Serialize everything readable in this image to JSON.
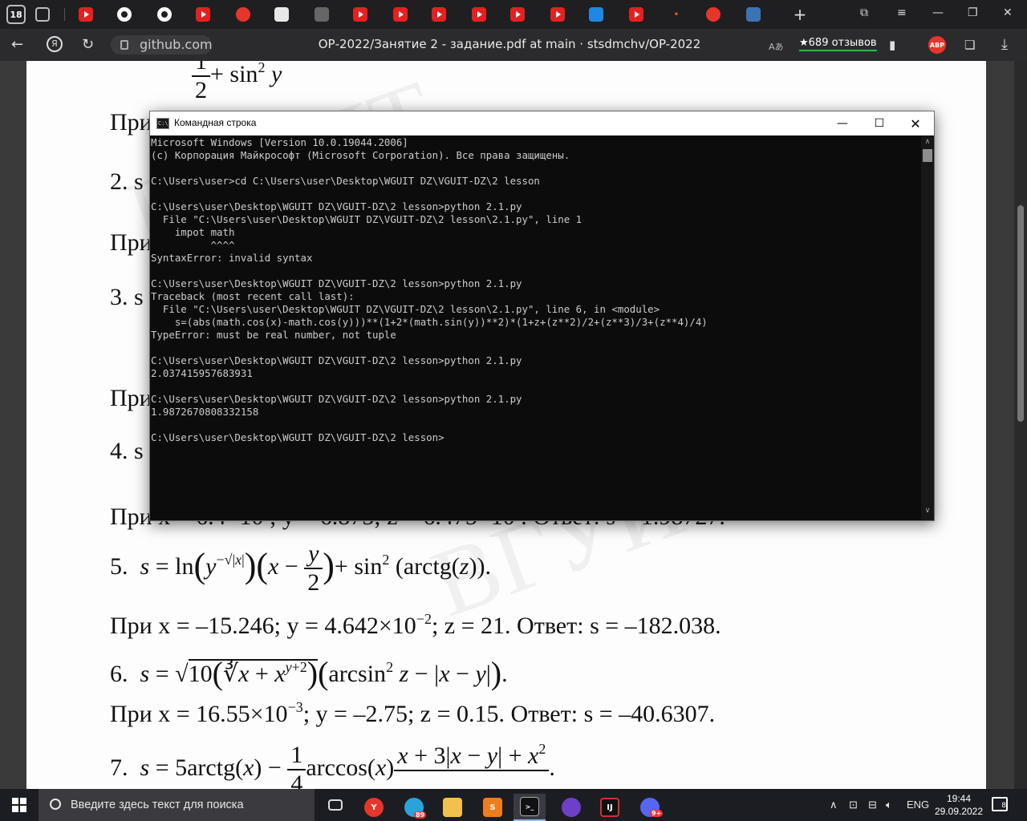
{
  "browser": {
    "tab_count": "18",
    "site": "github.com",
    "page_title": "ОР-2022/Занятие 2 - задание.pdf at main · stsdmchv/OP-2022",
    "reviews": "★689 отзывов",
    "adblock_badge": "АВР",
    "translate_label": "Aあ"
  },
  "cmd": {
    "title": "Командная строка",
    "lines": [
      "Microsoft Windows [Version 10.0.19044.2006]",
      "(c) Корпорация Майкрософт (Microsoft Corporation). Все права защищены.",
      "",
      "C:\\Users\\user>cd C:\\Users\\user\\Desktop\\WGUIT DZ\\VGUIT-DZ\\2 lesson",
      "",
      "C:\\Users\\user\\Desktop\\WGUIT DZ\\VGUIT-DZ\\2 lesson>python 2.1.py",
      "  File \"C:\\Users\\user\\Desktop\\WGUIT DZ\\VGUIT-DZ\\2 lesson\\2.1.py\", line 1",
      "    impot math",
      "          ^^^^",
      "SyntaxError: invalid syntax",
      "",
      "C:\\Users\\user\\Desktop\\WGUIT DZ\\VGUIT-DZ\\2 lesson>python 2.1.py",
      "Traceback (most recent call last):",
      "  File \"C:\\Users\\user\\Desktop\\WGUIT DZ\\VGUIT-DZ\\2 lesson\\2.1.py\", line 6, in <module>",
      "    s=(abs(math.cos(x)-math.cos(y)))**(1+2*(math.sin(y))**2)*(1+z+(z**2)/2+(z**3)/3+(z**4)/4)",
      "TypeError: must be real number, not tuple",
      "",
      "C:\\Users\\user\\Desktop\\WGUIT DZ\\VGUIT-DZ\\2 lesson>python 2.1.py",
      "2.037415957683931",
      "",
      "C:\\Users\\user\\Desktop\\WGUIT DZ\\VGUIT-DZ\\2 lesson>python 2.1.py",
      "1.9872670808332158",
      "",
      "C:\\Users\\user\\Desktop\\WGUIT DZ\\VGUIT-DZ\\2 lesson>"
    ]
  },
  "pdf": {
    "line_1_label": "При",
    "item_2": "2.  s",
    "line_2_label": "При",
    "item_3": "3.  s",
    "line_3_label": "При",
    "item_4": "4.  s",
    "line_4_visible": "При x = 6.4×10   ;  y =  6.875;  z = 6.475×10   .  Ответ: s = 1.98727.",
    "item_5": "5.",
    "line_5": "При x = –15.246;  y = 4.642×10",
    "line_5_exp": "−2",
    "line_5_rest": ";  z = 21.   Ответ: s = –182.038.",
    "item_6": "6.",
    "line_6": "При x = 16.55×10",
    "line_6_exp": "−3",
    "line_6_rest": ";  y = –2.75;  z = 0.15.   Ответ: s = –40.6307.",
    "item_7": "7."
  },
  "taskbar": {
    "search_placeholder": "Введите здесь текст для поиска",
    "telegram_badge": "89",
    "discord_badge": "9+",
    "language": "ENG",
    "time": "19:44",
    "date": "29.09.2022",
    "notifications": "8"
  }
}
